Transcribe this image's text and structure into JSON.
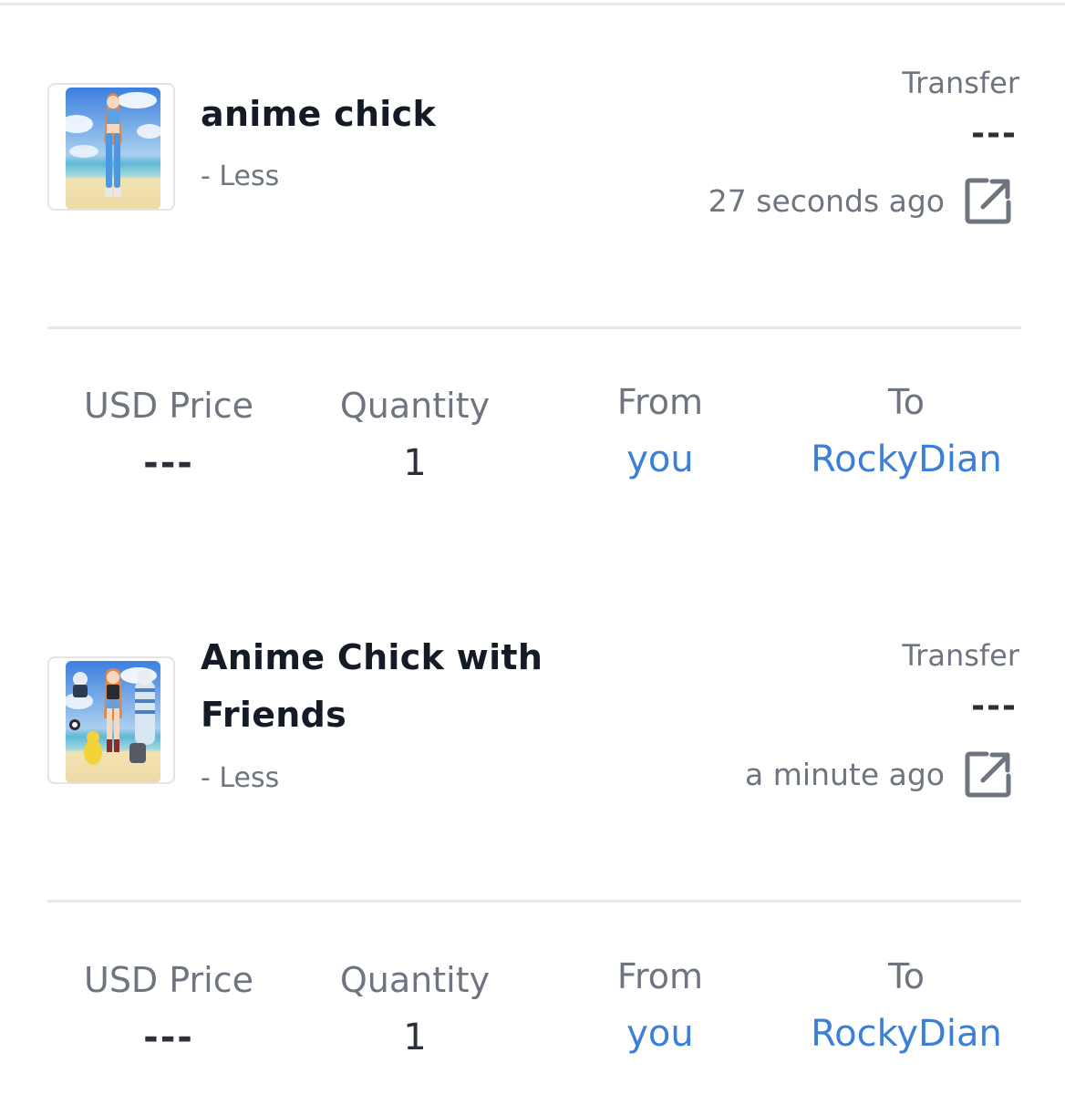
{
  "items": [
    {
      "title": "anime chick",
      "less_label": "- Less",
      "event_type": "Transfer",
      "price_right": "---",
      "time": "27 seconds ago",
      "details": {
        "usd_price_label": "USD Price",
        "usd_price_value": "---",
        "quantity_label": "Quantity",
        "quantity_value": "1",
        "from_label": "From",
        "from_value": "you",
        "to_label": "To",
        "to_value": "RockyDian"
      }
    },
    {
      "title": "Anime Chick with Friends",
      "less_label": "- Less",
      "event_type": "Transfer",
      "price_right": "---",
      "time": "a minute ago",
      "details": {
        "usd_price_label": "USD Price",
        "usd_price_value": "---",
        "quantity_label": "Quantity",
        "quantity_value": "1",
        "from_label": "From",
        "from_value": "you",
        "to_label": "To",
        "to_value": "RockyDian"
      }
    }
  ],
  "colors": {
    "link": "#3b7fd9",
    "muted": "#6f7580",
    "title": "#141a26",
    "divider": "#e6e7ea"
  },
  "icons": {
    "external": "external-link-icon"
  }
}
